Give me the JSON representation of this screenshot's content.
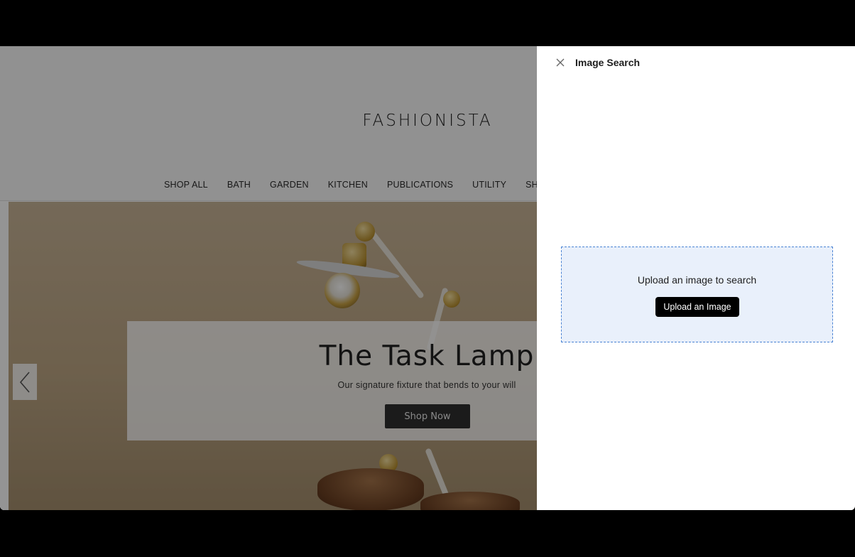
{
  "store": {
    "logo": "FASHIONISTA",
    "nav": [
      "SHOP ALL",
      "BATH",
      "GARDEN",
      "KITCHEN",
      "PUBLICATIONS",
      "UTILITY",
      "SHIPPING &"
    ],
    "hero": {
      "title": "The Task Lamp",
      "subtitle": "Our signature fixture that bends to your will",
      "cta": "Shop Now",
      "prev_icon": "chevron-left-icon"
    }
  },
  "drawer": {
    "title": "Image Search",
    "close_icon": "close-icon",
    "dropzone_text": "Upload an image to search",
    "upload_button": "Upload an Image"
  },
  "colors": {
    "overlay": "#000000",
    "dropzone_bg": "#e9f0fb",
    "dropzone_border": "#4a83d4",
    "upload_button_bg": "#000000"
  }
}
